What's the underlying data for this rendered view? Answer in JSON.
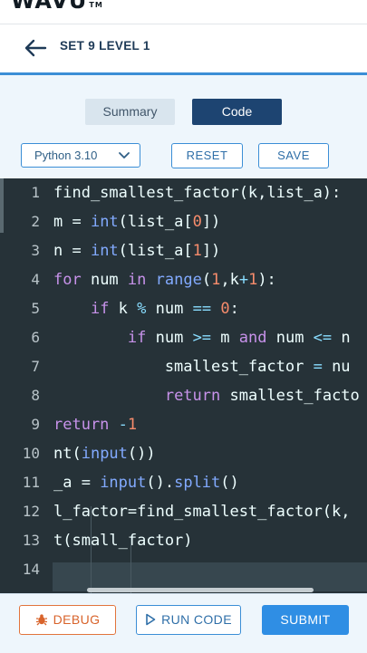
{
  "brand": {
    "logo_text": "WAVU",
    "tm": "TM"
  },
  "header": {
    "title": "SET 9 LEVEL 1",
    "back_icon": "arrow-left-icon"
  },
  "tabs": [
    {
      "label": "Summary",
      "active": false
    },
    {
      "label": "Code",
      "active": true
    }
  ],
  "toolbar": {
    "language_value": "Python 3.10",
    "reset_label": "RESET",
    "save_label": "SAVE"
  },
  "editor": {
    "line_numbers": [
      "1",
      "2",
      "3",
      "4",
      "5",
      "6",
      "7",
      "8",
      "9",
      "10",
      "11",
      "12",
      "13",
      "14"
    ],
    "active_line": 14,
    "lines": [
      [
        [
          "plain",
          "find_smallest_factor(k,list_a):"
        ]
      ],
      [
        [
          "plain",
          "m = "
        ],
        [
          "fn",
          "int"
        ],
        [
          "plain",
          "(list_a["
        ],
        [
          "num",
          "0"
        ],
        [
          "plain",
          "])"
        ]
      ],
      [
        [
          "plain",
          "n = "
        ],
        [
          "fn",
          "int"
        ],
        [
          "plain",
          "(list_a["
        ],
        [
          "num",
          "1"
        ],
        [
          "plain",
          "])"
        ]
      ],
      [
        [
          "kw",
          "for"
        ],
        [
          "plain",
          " num "
        ],
        [
          "kw",
          "in"
        ],
        [
          "plain",
          " "
        ],
        [
          "fn",
          "range"
        ],
        [
          "plain",
          "("
        ],
        [
          "num",
          "1"
        ],
        [
          "plain",
          ",k"
        ],
        [
          "op",
          "+"
        ],
        [
          "num",
          "1"
        ],
        [
          "plain",
          "):"
        ]
      ],
      [
        [
          "plain",
          "    "
        ],
        [
          "kw",
          "if"
        ],
        [
          "plain",
          " k "
        ],
        [
          "op",
          "%"
        ],
        [
          "plain",
          " num "
        ],
        [
          "op",
          "=="
        ],
        [
          "plain",
          " "
        ],
        [
          "num",
          "0"
        ],
        [
          "plain",
          ":"
        ]
      ],
      [
        [
          "plain",
          "        "
        ],
        [
          "kw",
          "if"
        ],
        [
          "plain",
          " num "
        ],
        [
          "op",
          ">="
        ],
        [
          "plain",
          " m "
        ],
        [
          "kw",
          "and"
        ],
        [
          "plain",
          " num "
        ],
        [
          "op",
          "<="
        ],
        [
          "plain",
          " n"
        ]
      ],
      [
        [
          "plain",
          "            smallest_factor "
        ],
        [
          "op",
          "="
        ],
        [
          "plain",
          " nu"
        ]
      ],
      [
        [
          "plain",
          "            "
        ],
        [
          "kw",
          "return"
        ],
        [
          "plain",
          " smallest_facto"
        ]
      ],
      [
        [
          "kw",
          "return"
        ],
        [
          "plain",
          " "
        ],
        [
          "op",
          "-"
        ],
        [
          "num",
          "1"
        ]
      ],
      [
        [
          "plain",
          "nt("
        ],
        [
          "fn",
          "input"
        ],
        [
          "plain",
          "())"
        ]
      ],
      [
        [
          "plain",
          "_a = "
        ],
        [
          "fn",
          "input"
        ],
        [
          "plain",
          "()."
        ],
        [
          "fn",
          "split"
        ],
        [
          "plain",
          "()"
        ]
      ],
      [
        [
          "plain",
          "l_factor=find_smallest_factor(k,"
        ]
      ],
      [
        [
          "plain",
          "t(small_factor)"
        ]
      ],
      [
        [
          "plain",
          ""
        ]
      ]
    ]
  },
  "footer": {
    "debug_label": "DEBUG",
    "run_label": "RUN CODE",
    "submit_label": "SUBMIT"
  },
  "colors": {
    "accent": "#3b8ed6",
    "tab_active": "#1d4471",
    "editor_bg": "#263238",
    "debug": "#e2743c",
    "submit": "#2f8ee4"
  }
}
